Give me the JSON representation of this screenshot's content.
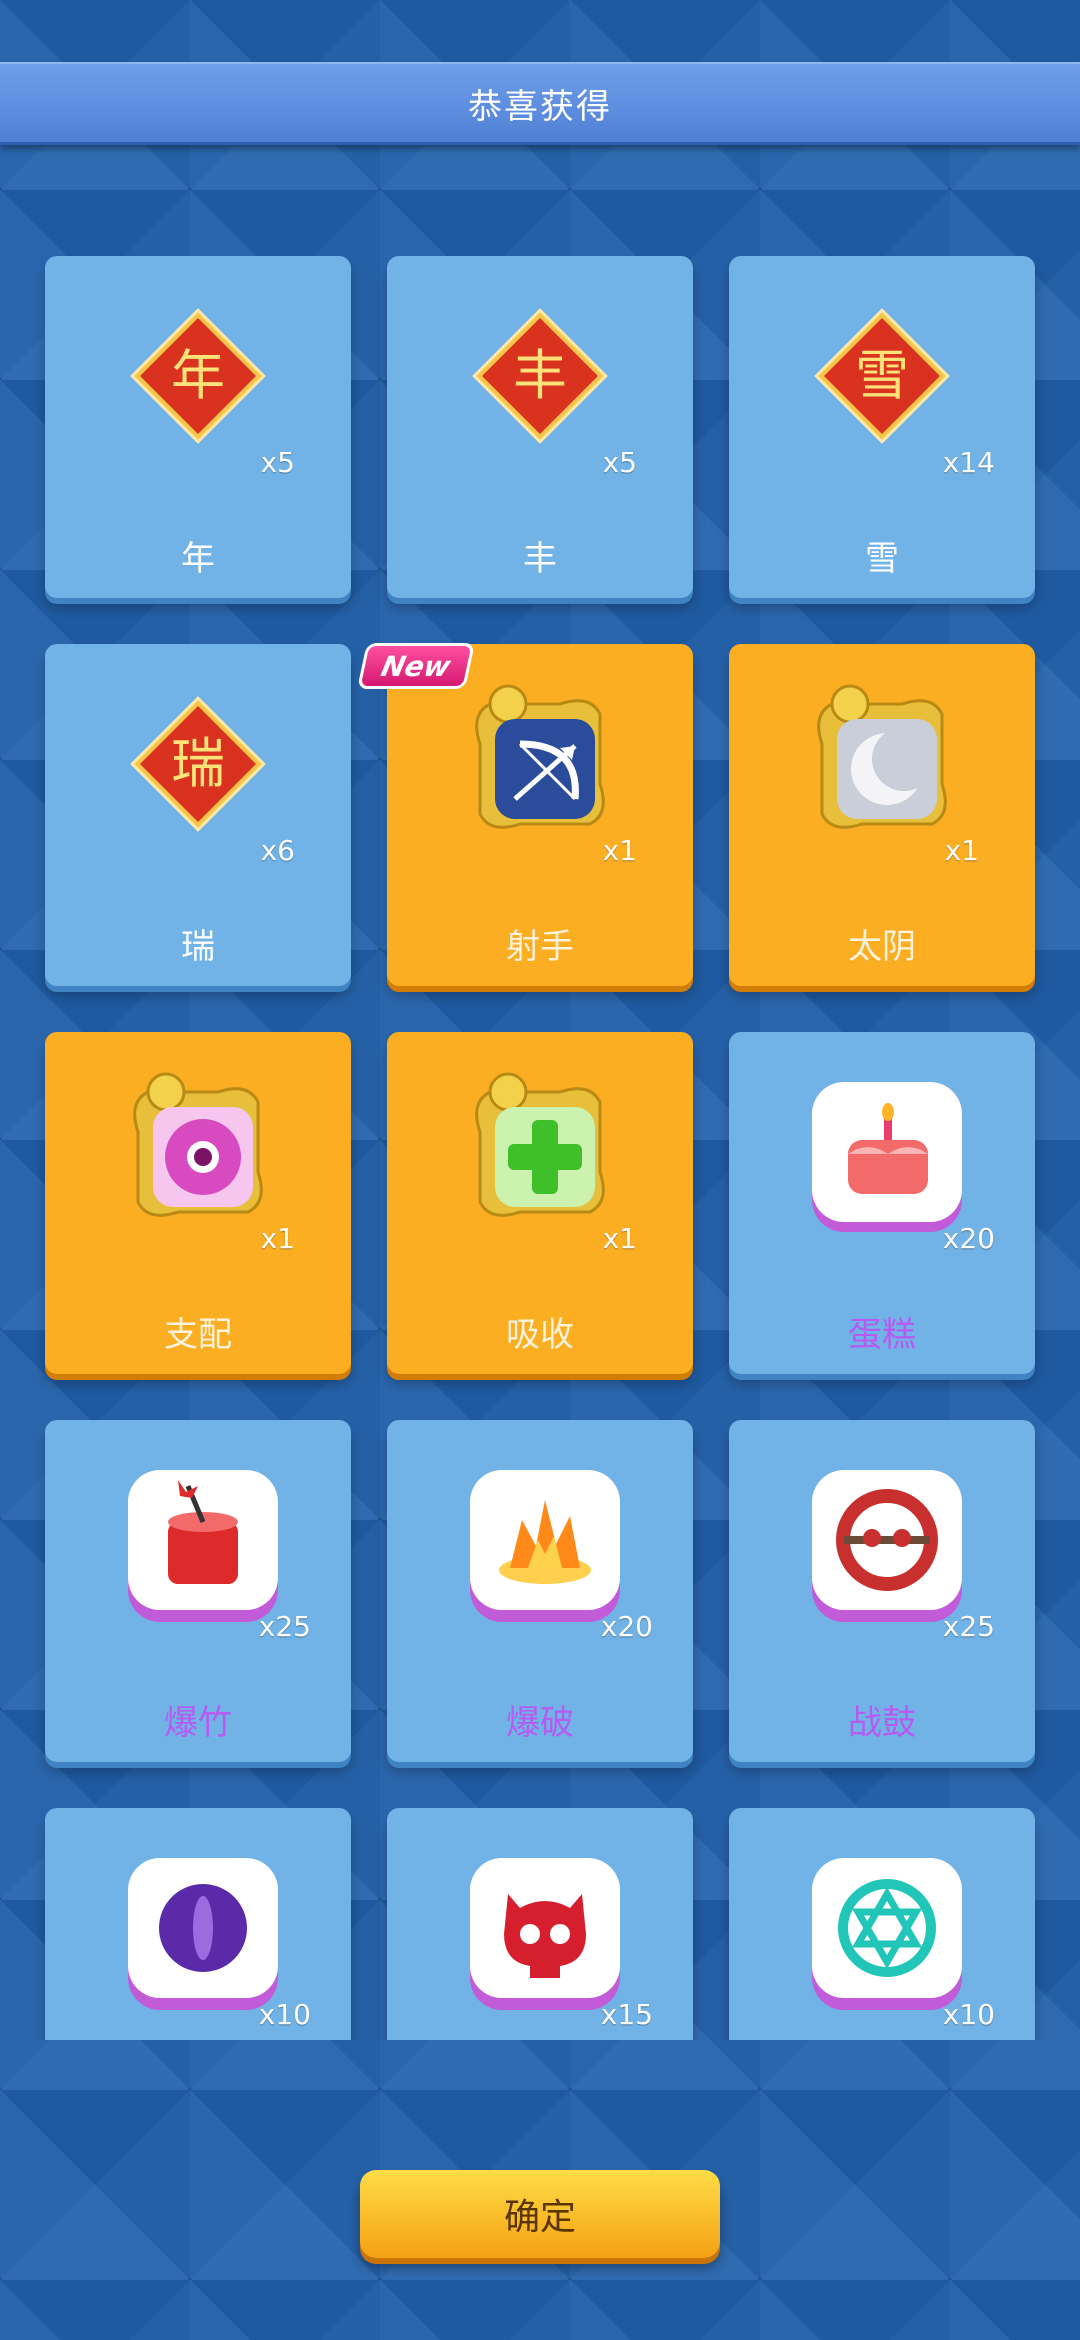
{
  "header": {
    "title": "恭喜获得"
  },
  "items": [
    {
      "label": "年",
      "qty": "x5",
      "kind": "fu",
      "char": "年",
      "style": "blue"
    },
    {
      "label": "丰",
      "qty": "x5",
      "kind": "fu",
      "char": "丰",
      "style": "blue"
    },
    {
      "label": "雪",
      "qty": "x14",
      "kind": "fu",
      "char": "雪",
      "style": "blue"
    },
    {
      "label": "瑞",
      "qty": "x6",
      "kind": "fu",
      "char": "瑞",
      "style": "blue"
    },
    {
      "label": "射手",
      "qty": "x1",
      "kind": "dragon-frame",
      "icon": "bow-arrow-icon",
      "style": "gold",
      "badge": "New"
    },
    {
      "label": "太阴",
      "qty": "x1",
      "kind": "dragon-frame",
      "icon": "moon-icon",
      "style": "gold"
    },
    {
      "label": "支配",
      "qty": "x1",
      "kind": "dragon-frame",
      "icon": "eye-icon",
      "style": "gold"
    },
    {
      "label": "吸收",
      "qty": "x1",
      "kind": "dragon-frame",
      "icon": "plus-icon",
      "style": "gold"
    },
    {
      "label": "蛋糕",
      "qty": "x20",
      "kind": "tile",
      "icon": "cake-icon",
      "style": "blue-purple"
    },
    {
      "label": "爆竹",
      "qty": "x25",
      "kind": "tile",
      "icon": "firecracker-icon",
      "style": "blue-purple"
    },
    {
      "label": "爆破",
      "qty": "x20",
      "kind": "tile",
      "icon": "explosion-icon",
      "style": "blue-purple"
    },
    {
      "label": "战鼓",
      "qty": "x25",
      "kind": "tile",
      "icon": "war-drum-icon",
      "style": "blue-purple"
    },
    {
      "label": "",
      "qty": "x10",
      "kind": "tile",
      "icon": "purple-eye-icon",
      "style": "blue-purple"
    },
    {
      "label": "",
      "qty": "x15",
      "kind": "tile",
      "icon": "skull-icon",
      "style": "blue-purple"
    },
    {
      "label": "",
      "qty": "x10",
      "kind": "tile",
      "icon": "hexagram-icon",
      "style": "blue-purple"
    }
  ],
  "confirm_button": {
    "label": "确定"
  },
  "colors": {
    "card_blue": "#71b3e6",
    "card_gold": "#fcae23",
    "label_purple": "#b65bf0",
    "fu_red": "#d9321f"
  }
}
